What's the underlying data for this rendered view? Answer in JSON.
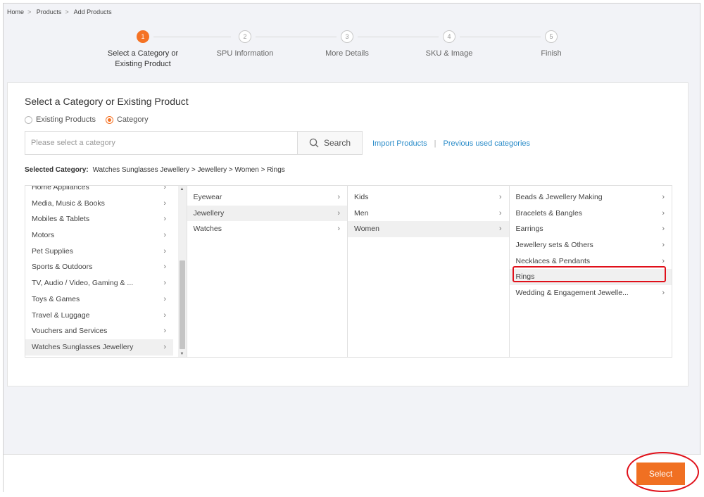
{
  "breadcrumb": [
    "Home",
    "Products",
    "Add Products"
  ],
  "breadcrumb_separator": ">",
  "steps": [
    {
      "num": "1",
      "line1": "Select a Category or",
      "line2": "Existing Product",
      "active": true
    },
    {
      "num": "2",
      "line1": "SPU Information",
      "line2": "",
      "active": false
    },
    {
      "num": "3",
      "line1": "More Details",
      "line2": "",
      "active": false
    },
    {
      "num": "4",
      "line1": "SKU & Image",
      "line2": "",
      "active": false
    },
    {
      "num": "5",
      "line1": "Finish",
      "line2": "",
      "active": false
    }
  ],
  "panel": {
    "title": "Select a Category or Existing Product",
    "radio_existing": "Existing Products",
    "radio_category": "Category",
    "selected_radio": "Category",
    "search_placeholder": "Please select a category",
    "search_button": "Search",
    "import_link": "Import Products",
    "link_divider": "|",
    "previous_link": "Previous used categories",
    "selected_label": "Selected Category:",
    "selected_path": "Watches Sunglasses Jewellery > Jewellery > Women > Rings"
  },
  "columns": {
    "level1": [
      {
        "label": "Home Appliances",
        "has_children": true
      },
      {
        "label": "Media, Music & Books",
        "has_children": true
      },
      {
        "label": "Mobiles & Tablets",
        "has_children": true
      },
      {
        "label": "Motors",
        "has_children": true
      },
      {
        "label": "Pet Supplies",
        "has_children": true
      },
      {
        "label": "Sports & Outdoors",
        "has_children": true
      },
      {
        "label": "TV, Audio / Video, Gaming & ...",
        "has_children": true
      },
      {
        "label": "Toys & Games",
        "has_children": true
      },
      {
        "label": "Travel & Luggage",
        "has_children": true
      },
      {
        "label": "Vouchers and Services",
        "has_children": true
      },
      {
        "label": "Watches Sunglasses Jewellery",
        "has_children": true,
        "selected": true
      }
    ],
    "level2": [
      {
        "label": "Eyewear",
        "has_children": true
      },
      {
        "label": "Jewellery",
        "has_children": true,
        "selected": true
      },
      {
        "label": "Watches",
        "has_children": true
      }
    ],
    "level3": [
      {
        "label": "Kids",
        "has_children": true
      },
      {
        "label": "Men",
        "has_children": true
      },
      {
        "label": "Women",
        "has_children": true,
        "selected": true
      }
    ],
    "level4": [
      {
        "label": "Beads & Jewellery Making",
        "has_children": true
      },
      {
        "label": "Bracelets & Bangles",
        "has_children": true
      },
      {
        "label": "Earrings",
        "has_children": true
      },
      {
        "label": "Jewellery sets & Others",
        "has_children": true
      },
      {
        "label": "Necklaces & Pendants",
        "has_children": true
      },
      {
        "label": "Rings",
        "has_children": false,
        "selected": true
      },
      {
        "label": "Wedding & Engagement Jewelle...",
        "has_children": true
      }
    ]
  },
  "footer": {
    "select_button": "Select"
  },
  "icons": {
    "chevron": "chevron-right-icon",
    "search": "search-icon"
  },
  "colors": {
    "accent": "#f57224",
    "link": "#2a8cc9",
    "highlight": "#e0101a"
  }
}
